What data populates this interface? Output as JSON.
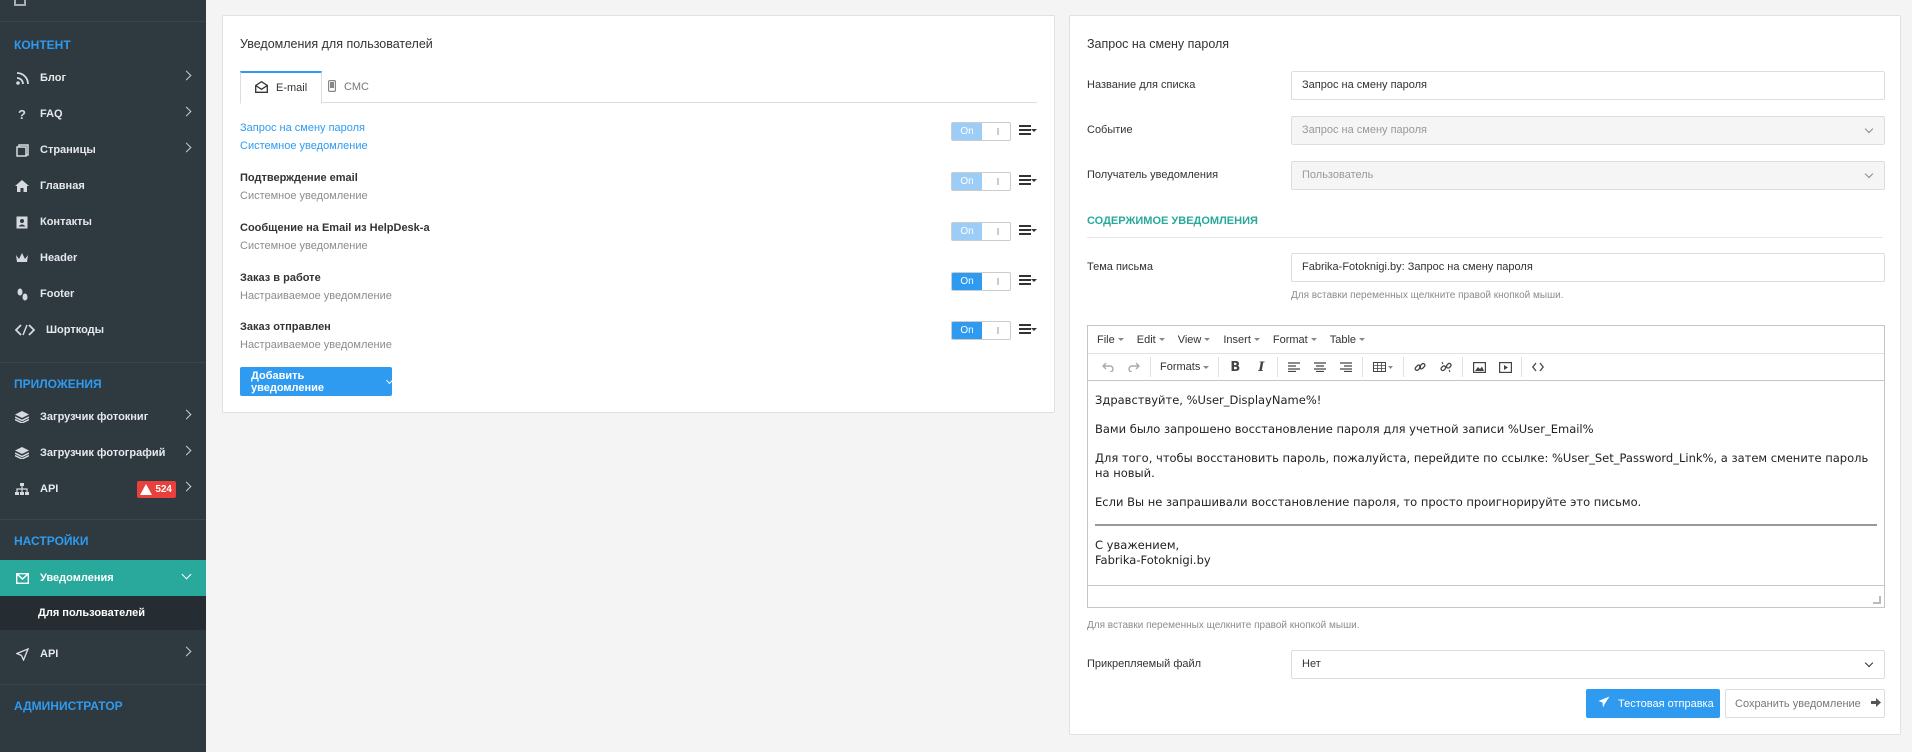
{
  "sidebar": {
    "sections": {
      "content": "КОНТЕНТ",
      "apps": "ПРИЛОЖЕНИЯ",
      "settings": "НАСТРОЙКИ",
      "admin": "АДМИНИСТРАТОР"
    },
    "content_items": [
      "Блог",
      "FAQ",
      "Страницы",
      "Главная",
      "Контакты",
      "Header",
      "Footer",
      "Шорткоды"
    ],
    "app_items": [
      "Загрузчик фотокниг",
      "Загрузчик фотографий",
      "API"
    ],
    "api_badge": "524",
    "settings_items": {
      "notifications": "Уведомления",
      "for_users": "Для пользователей",
      "api": "API"
    }
  },
  "left_panel": {
    "title": "Уведомления для пользователей",
    "tabs": {
      "email": "E-mail",
      "sms": "СМС"
    },
    "toggle_label": "On",
    "rows": [
      {
        "title": "Запрос на смену пароля",
        "subtitle": "Системное уведомление"
      },
      {
        "title": "Подтверждение email",
        "subtitle": "Системное уведомление"
      },
      {
        "title": "Сообщение на Email из HelpDesk-a",
        "subtitle": "Системное уведомление"
      },
      {
        "title": "Заказ в работе",
        "subtitle": "Настраиваемое уведомление"
      },
      {
        "title": "Заказ отправлен",
        "subtitle": "Настраиваемое уведомление"
      }
    ],
    "add_button": "Добавить уведомление"
  },
  "right_panel": {
    "title": "Запрос на смену пароля",
    "list_name_label": "Название для списка",
    "list_name_value": "Запрос на смену пароля",
    "event_label": "Событие",
    "event_value": "Запрос на смену пароля",
    "recipient_label": "Получатель уведомления",
    "recipient_value": "Пользователь",
    "section_title": "СОДЕРЖИМОЕ УВЕДОМЛЕНИЯ",
    "subject_label": "Тема письма",
    "subject_value": "Fabrika-Fotoknigi.by: Запрос на смену пароля",
    "hint": "Для вставки переменных щелкните правой кнопкой мыши.",
    "editor": {
      "menu": [
        "File",
        "Edit",
        "View",
        "Insert",
        "Format",
        "Table"
      ],
      "formats": "Formats",
      "body": {
        "greeting": "Здравствуйте, %User_DisplayName%!",
        "line1": "Вами было запрошено восстановление пароля для учетной записи %User_Email%",
        "line2": "Для того, чтобы восстановить пароль, пожалуйста, перейдите по ссылке: %User_Set_Password_Link%, а затем смените пароль на новый.",
        "line3": "Если Вы не запрашивали восстановление пароля, то просто проигнорируйте это письмо.",
        "sign1": "С уважением,",
        "sign2": "Fabrika-Fotoknigi.by"
      }
    },
    "attachment_label": "Прикрепляемый файл",
    "attachment_value": "Нет",
    "test_button": "Тестовая отправка",
    "save_button": "Сохранить уведомление"
  },
  "colors": {
    "accent": "#2f9bf0",
    "teal": "#28a99c",
    "sidebar_bg": "#2f3940",
    "badge_red": "#e8413b"
  }
}
